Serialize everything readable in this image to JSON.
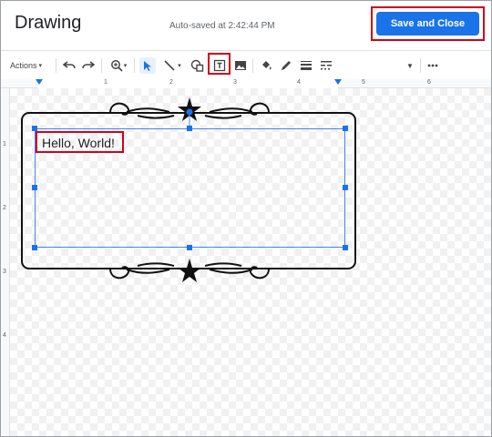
{
  "header": {
    "title": "Drawing",
    "autosave": "Auto-saved at 2:42:44 PM",
    "save_label": "Save and Close"
  },
  "toolbar": {
    "actions_label": "Actions",
    "tools": [
      "undo-icon",
      "redo-icon",
      "zoom-icon",
      "select-icon",
      "line-icon",
      "shape-icon",
      "text-box-icon",
      "image-icon",
      "fill-color-icon",
      "pen-icon",
      "line-weight-icon",
      "line-dash-icon",
      "more-icon"
    ]
  },
  "ruler": {
    "labels": [
      "1",
      "2",
      "3",
      "4",
      "5",
      "6"
    ]
  },
  "vruler": {
    "labels": [
      "1",
      "2",
      "3",
      "4"
    ]
  },
  "canvas": {
    "text": "Hello, World!"
  },
  "colors": {
    "accent": "#1a73e8",
    "highlight": "#d0021b"
  }
}
